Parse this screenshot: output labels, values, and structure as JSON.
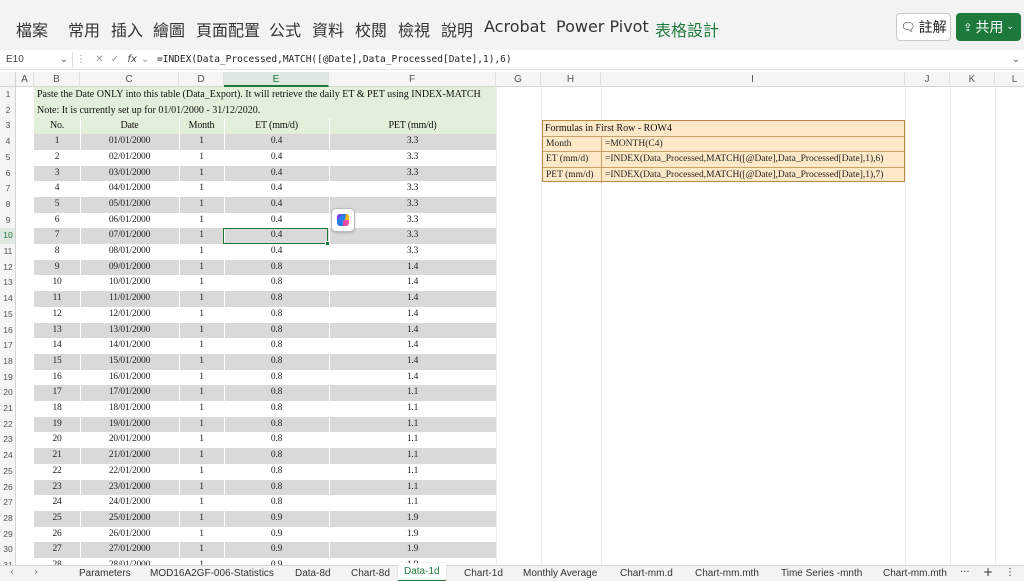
{
  "ribbon": {
    "tabs": [
      "檔案",
      "常用",
      "插入",
      "繪圖",
      "頁面配置",
      "公式",
      "資料",
      "校閱",
      "檢視",
      "說明",
      "Acrobat",
      "Power Pivot",
      "表格設計"
    ],
    "comment_label": "註解",
    "share_label": "共用",
    "accent_color": "#1e7a3c"
  },
  "formula_bar": {
    "name_box": "E10",
    "fx": "fx",
    "formula": "=INDEX(Data_Processed,MATCH([@Date],Data_Processed[Date],1),6)"
  },
  "columns": [
    "A",
    "B",
    "C",
    "D",
    "E",
    "F",
    "G",
    "H",
    "I",
    "J",
    "K",
    "L"
  ],
  "selected_column": "E",
  "selected_row": "10",
  "rows": [
    "1",
    "2",
    "3",
    "4",
    "5",
    "6",
    "7",
    "8",
    "9",
    "10",
    "11",
    "12",
    "13",
    "14",
    "15",
    "16",
    "17",
    "18",
    "19",
    "20",
    "21",
    "22",
    "23",
    "24",
    "25",
    "26",
    "27",
    "28",
    "29",
    "30",
    "31"
  ],
  "notes": {
    "line1": "Paste the Date ONLY into this table (Data_Export). It will retrieve the daily ET & PET using INDEX-MATCH",
    "line2": "Note: It is currently set up for 01/01/2000 - 31/12/2020."
  },
  "table": {
    "headers": [
      "No.",
      "Date",
      "Month",
      "ET (mm/d)",
      "PET (mm/d)"
    ],
    "rows": [
      [
        "1",
        "01/01/2000",
        "1",
        "0.4",
        "3.3"
      ],
      [
        "2",
        "02/01/2000",
        "1",
        "0.4",
        "3.3"
      ],
      [
        "3",
        "03/01/2000",
        "1",
        "0.4",
        "3.3"
      ],
      [
        "4",
        "04/01/2000",
        "1",
        "0.4",
        "3.3"
      ],
      [
        "5",
        "05/01/2000",
        "1",
        "0.4",
        "3.3"
      ],
      [
        "6",
        "06/01/2000",
        "1",
        "0.4",
        "3.3"
      ],
      [
        "7",
        "07/01/2000",
        "1",
        "0.4",
        "3.3"
      ],
      [
        "8",
        "08/01/2000",
        "1",
        "0.4",
        "3.3"
      ],
      [
        "9",
        "09/01/2000",
        "1",
        "0.8",
        "1.4"
      ],
      [
        "10",
        "10/01/2000",
        "1",
        "0.8",
        "1.4"
      ],
      [
        "11",
        "11/01/2000",
        "1",
        "0.8",
        "1.4"
      ],
      [
        "12",
        "12/01/2000",
        "1",
        "0.8",
        "1.4"
      ],
      [
        "13",
        "13/01/2000",
        "1",
        "0.8",
        "1.4"
      ],
      [
        "14",
        "14/01/2000",
        "1",
        "0.8",
        "1.4"
      ],
      [
        "15",
        "15/01/2000",
        "1",
        "0.8",
        "1.4"
      ],
      [
        "16",
        "16/01/2000",
        "1",
        "0.8",
        "1.4"
      ],
      [
        "17",
        "17/01/2000",
        "1",
        "0.8",
        "1.1"
      ],
      [
        "18",
        "18/01/2000",
        "1",
        "0.8",
        "1.1"
      ],
      [
        "19",
        "19/01/2000",
        "1",
        "0.8",
        "1.1"
      ],
      [
        "20",
        "20/01/2000",
        "1",
        "0.8",
        "1.1"
      ],
      [
        "21",
        "21/01/2000",
        "1",
        "0.8",
        "1.1"
      ],
      [
        "22",
        "22/01/2000",
        "1",
        "0.8",
        "1.1"
      ],
      [
        "23",
        "23/01/2000",
        "1",
        "0.8",
        "1.1"
      ],
      [
        "24",
        "24/01/2000",
        "1",
        "0.8",
        "1.1"
      ],
      [
        "25",
        "25/01/2000",
        "1",
        "0.9",
        "1.9"
      ],
      [
        "26",
        "26/01/2000",
        "1",
        "0.9",
        "1.9"
      ],
      [
        "27",
        "27/01/2000",
        "1",
        "0.9",
        "1.9"
      ],
      [
        "28",
        "28/01/2000",
        "1",
        "0.9",
        "1.9"
      ]
    ]
  },
  "formulas_box": {
    "title": "Formulas in First Row - ROW4",
    "rows": [
      {
        "label": "Month",
        "value": "=MONTH(C4)"
      },
      {
        "label": "ET (mm/d)",
        "value": "=INDEX(Data_Processed,MATCH([@Date],Data_Processed[Date],1),6)"
      },
      {
        "label": "PET (mm/d)",
        "value": "=INDEX(Data_Processed,MATCH([@Date],Data_Processed[Date],1),7)"
      }
    ]
  },
  "sheet_tabs": {
    "tabs": [
      "Parameters",
      "MOD16A2GF-006-Statistics",
      "Data-8d",
      "Chart-8d",
      "Data-1d",
      "Chart-1d",
      "Monthly Average",
      "Chart-mm.d",
      "Chart-mm.mth",
      "Time Series -mnth",
      "Chart-mm.mth"
    ],
    "active": "Data-1d",
    "more": "···",
    "add": "+"
  }
}
